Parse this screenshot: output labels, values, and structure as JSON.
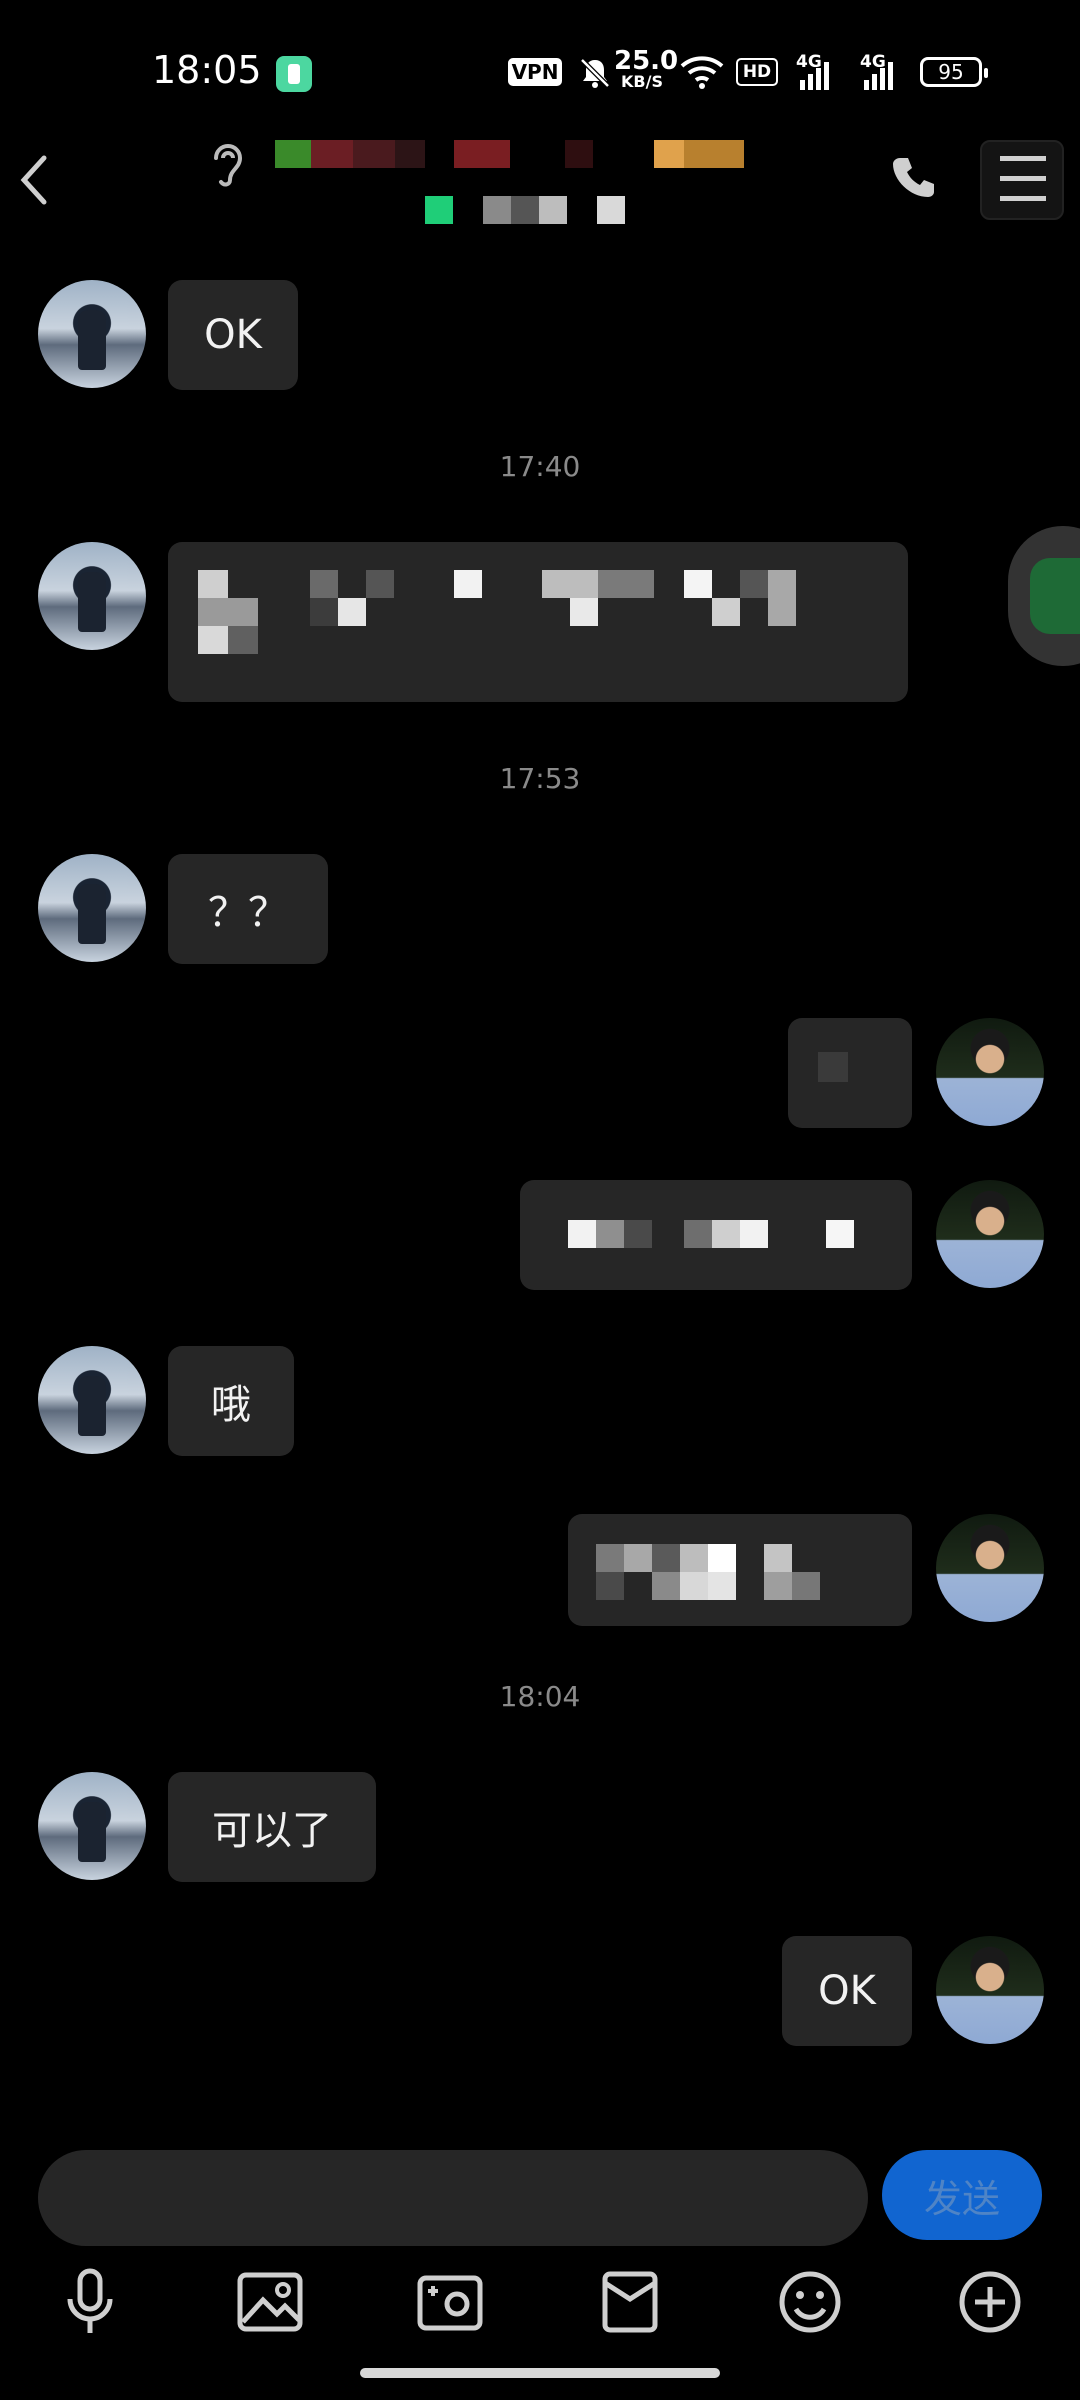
{
  "status_bar": {
    "time": "18:05",
    "vpn": "VPN",
    "speed_value": "25.0",
    "speed_unit": "KB/S",
    "hd": "HD",
    "net1": "4G",
    "net2": "4G",
    "battery": "95",
    "icons": [
      "app-icon",
      "vpn-icon",
      "mute-icon",
      "wifi-icon",
      "hd-icon",
      "signal-icon",
      "battery-icon"
    ]
  },
  "header": {
    "back_icon": "chevron-left-icon",
    "ear_icon": "ear-icon",
    "call_icon": "phone-icon",
    "menu_icon": "menu-icon"
  },
  "messages": {
    "m1": "OK",
    "ts1": "17:40",
    "ts2": "17:53",
    "m3": "？？",
    "m6": "哦",
    "ts3": "18:04",
    "m8": "可以了",
    "m9": "OK"
  },
  "input": {
    "send": "发送",
    "tools": [
      "microphone-icon",
      "image-icon",
      "camera-icon",
      "red-packet-icon",
      "emoji-icon",
      "plus-icon"
    ]
  },
  "colors": {
    "background": "#000000",
    "bubble": "#262626",
    "send": "#1165d0"
  }
}
